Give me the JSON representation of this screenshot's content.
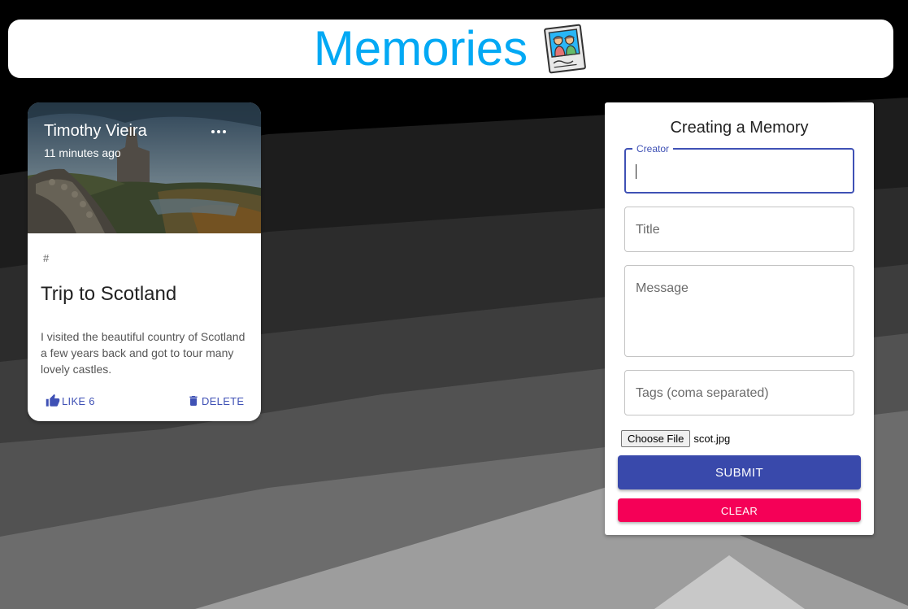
{
  "header": {
    "title": "Memories",
    "logo_icon": "memories-photo-icon"
  },
  "posts": [
    {
      "creator": "Timothy Vieira",
      "time_ago": "11 minutes ago",
      "tags": "#",
      "title": "Trip to Scotland",
      "message": "I visited the beautiful country of Scotland a few years back and got to tour many lovely castles.",
      "like_label": "LIKE 6",
      "delete_label": "DELETE",
      "image_icon": "castle-landscape-photo"
    }
  ],
  "form": {
    "heading": "Creating a Memory",
    "creator_label": "Creator",
    "creator_value": "",
    "title_label": "Title",
    "message_label": "Message",
    "tags_label": "Tags (coma separated)",
    "file_button_label": "Choose File",
    "file_name": "scot.jpg",
    "submit_label": "SUBMIT",
    "clear_label": "CLEAR"
  },
  "colors": {
    "accent": "#03a9f4",
    "primary": "#3f51b5",
    "secondary": "#f50057"
  }
}
